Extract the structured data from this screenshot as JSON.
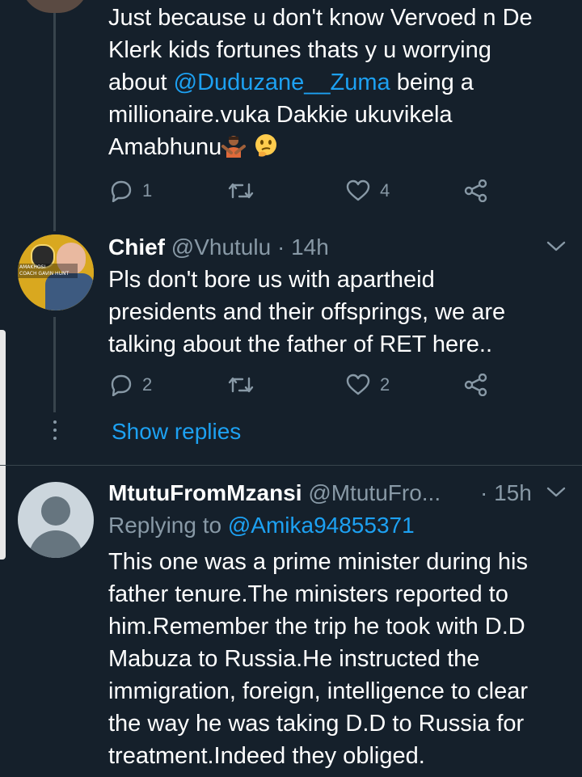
{
  "tweet1": {
    "text_line1": "Just because u don't know Vervoed n De",
    "text_line2": "Klerk kids fortunes thats y u worrying",
    "text_line3_pre": "about ",
    "mention": "@Duduzane__Zuma",
    "text_line3_post": " being a",
    "text_line4": "millionaire.vuka Dakkie ukuvikela",
    "text_line5": "Amabhunu",
    "emoji1": "person-gesturing-no",
    "emoji2": "thinking-face",
    "reply_count": "1",
    "retweet_count": "",
    "like_count": "4"
  },
  "tweet2": {
    "name": "Chief",
    "handle": "@Vhutulu",
    "separator": "·",
    "time": "14h",
    "avatar_text_line1": "AMAKHOSI",
    "avatar_text_line2": "COACH GAVIN HUNT",
    "text_line1": "Pls don't bore us with apartheid",
    "text_line2": "presidents and their offsprings, we are",
    "text_line3": "talking about the father of RET here..",
    "reply_count": "2",
    "like_count": "2",
    "show_replies": "Show replies"
  },
  "tweet3": {
    "name": "MtutuFromMzansi",
    "handle": "@MtutuFro...",
    "separator": "·",
    "time": "15h",
    "replying_label": "Replying to ",
    "replying_to": "@Amika94855371",
    "text_line1": "This one was a prime minister during his",
    "text_line2": "father tenure.The ministers reported to",
    "text_line3": "him.Remember the trip he took with D.D",
    "text_line4": "Mabuza to Russia.He instructed the",
    "text_line5": "immigration, foreign, intelligence to clear",
    "text_line6": "the way he was taking D.D to Russia for",
    "text_line7": "treatment.Indeed they obliged."
  },
  "colors": {
    "background": "#15202b",
    "accent": "#1da1f2",
    "muted": "#8899a6",
    "divider": "#38444d"
  }
}
